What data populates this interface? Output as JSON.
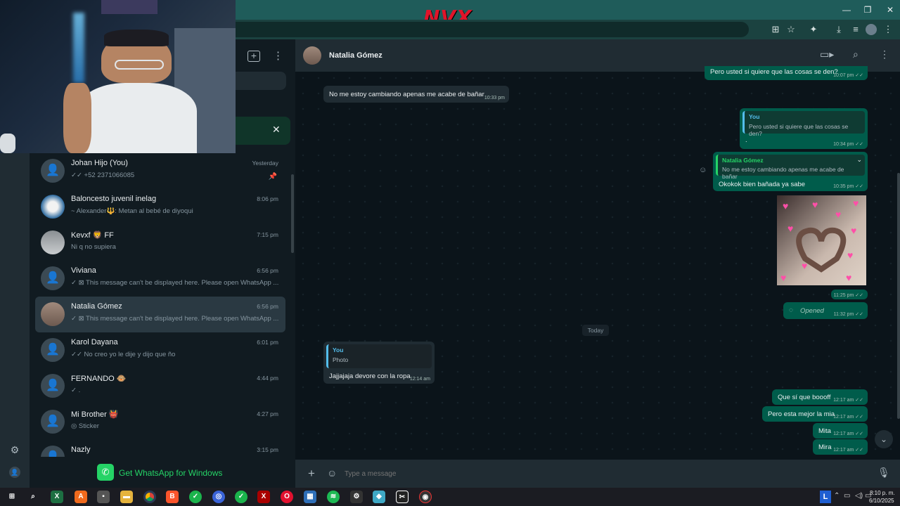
{
  "browser": {
    "brand_logo": "NVX",
    "minimize": "—",
    "restore": "❐",
    "close": "✕"
  },
  "left_panel": {
    "new_chat_icon": "+",
    "menu_icon": "⋮",
    "banner_close": "✕",
    "get_app_label": "Get WhatsApp for Windows",
    "chats": [
      {
        "name": "Johan Hijo (You)",
        "time": "Yesterday",
        "preview": "✓✓ +52 2371066085"
      },
      {
        "name": "Baloncesto juvenil inelag",
        "time": "8:06 pm",
        "preview": "~ Alexander🔱: Metan al bebé de diyoqui"
      },
      {
        "name": "Kevxf 🦁 FF",
        "time": "7:15 pm",
        "preview": "Ni q no supiera"
      },
      {
        "name": "Viviana",
        "time": "6:56 pm",
        "preview": "✓ ⊠ This message can't be displayed here. Please open WhatsApp ..."
      },
      {
        "name": "Natalia Gómez",
        "time": "6:56 pm",
        "preview": "✓ ⊠ This message can't be displayed here. Please open WhatsApp ..."
      },
      {
        "name": "Karol Dayana",
        "time": "6:01 pm",
        "preview": "✓✓ No creo yo le dije y dijo que ño"
      },
      {
        "name": "FERNANDO 🐵",
        "time": "4:44 pm",
        "preview": "✓ ."
      },
      {
        "name": "Mi Brother 👹",
        "time": "4:27 pm",
        "preview": "◎ Sticker"
      },
      {
        "name": "Nazly",
        "time": "3:15 pm",
        "preview": ""
      }
    ]
  },
  "chat": {
    "contact_name": "Natalia Gómez",
    "composer_placeholder": "Type a message",
    "date_divider": "Today",
    "messages": {
      "m0": {
        "text": "Pero usted si quiere que las cosas se den?",
        "time": "10:07 pm ✓✓"
      },
      "m1": {
        "text": "No me estoy cambiando apenas me acabe de bañar",
        "time": "10:33 pm"
      },
      "m2": {
        "quote_author": "You",
        "quote_text": "Pero usted si quiere que las cosas se den?",
        "text": ".",
        "time": "10:34 pm ✓✓"
      },
      "m3": {
        "quote_author": "Natalia Gómez",
        "quote_text": "No me estoy cambiando apenas me acabe de bañar",
        "text": "Okokok bien bañada ya sabe",
        "time": "10:35 pm ✓✓"
      },
      "m4": {
        "time": "11:25 pm ✓✓"
      },
      "m5": {
        "text": "Opened",
        "time": "11:32 pm ✓✓"
      },
      "m6": {
        "quote_author": "You",
        "quote_text": "Photo",
        "text": "Jajjajaja devore con la ropa",
        "time": "12:14 am"
      },
      "m7": {
        "text": "Que sí que boooff",
        "time": "12:17 am ✓✓"
      },
      "m8": {
        "text": "Pero esta mejor la mia",
        "time": "12:17 am ✓✓"
      },
      "m9": {
        "text": "Mita",
        "time": "12:17 am ✓✓"
      },
      "m10": {
        "text": "Mira",
        "time": "12:17 am ✓✓"
      }
    }
  },
  "taskbar": {
    "lang": "L",
    "time": "8:10 p. m.",
    "date": "6/10/2025"
  },
  "colors": {
    "app_bg": "#111b21",
    "outgoing": "#005c4b",
    "incoming": "#202c33",
    "accent": "#25d366"
  }
}
